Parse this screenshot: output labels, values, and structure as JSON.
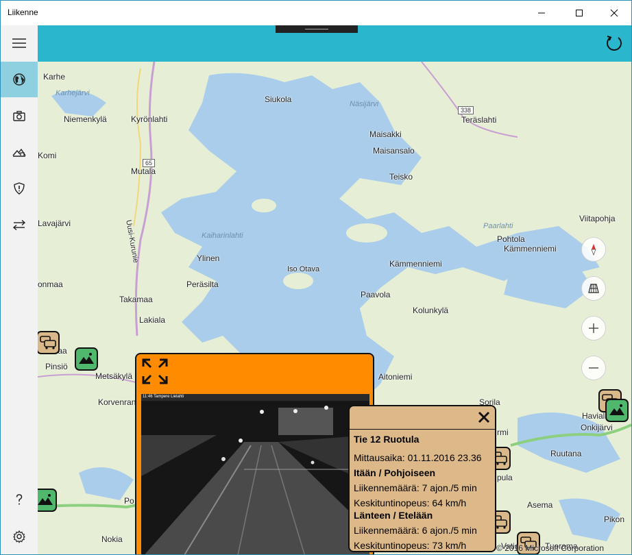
{
  "app": {
    "title": "Liikenne"
  },
  "window_controls": {
    "minimize": "minimize-icon",
    "maximize": "maximize-icon",
    "close": "close-icon"
  },
  "sidebar": {
    "items": [
      {
        "name": "menu",
        "icon": "hamburger-icon",
        "selected": false
      },
      {
        "name": "map",
        "icon": "globe-icon",
        "selected": true
      },
      {
        "name": "cameras",
        "icon": "camera-icon",
        "selected": false
      },
      {
        "name": "weather",
        "icon": "weather-icon",
        "selected": false
      },
      {
        "name": "traffic-safety",
        "icon": "shield-icon",
        "selected": false
      },
      {
        "name": "traffic-flow",
        "icon": "swap-arrows-icon",
        "selected": false
      },
      {
        "name": "help",
        "icon": "help-icon",
        "selected": false
      },
      {
        "name": "settings",
        "icon": "gear-icon",
        "selected": false
      }
    ]
  },
  "toolbar": {
    "refresh_icon": "refresh-icon",
    "accent": "#2ab7cd"
  },
  "map": {
    "places": [
      "Karhe",
      "Niemenkylä",
      "Kyrönlahti",
      "Komi",
      "Mutala",
      "Lavajärvi",
      "Ylinen",
      "Peräsilta",
      "Takamaa",
      "Lakiala",
      "Pinsiö",
      "Metsäkylä",
      "Korvenranta",
      "Nokia",
      "Siukola",
      "Maisakki",
      "Maisansalo",
      "Teisko",
      "Teräslahti",
      "Kämmenniemi",
      "Paavola",
      "Kolunkylä",
      "Aitoniemi",
      "Sorila",
      "Havialan",
      "Onkijärvi",
      "Ruutana",
      "Asema",
      "Pikon",
      "Pohtola",
      "Kämmenniemi",
      "Viitapohja",
      "Iso Otava",
      "Uusi-Kurunie",
      "onmaa",
      "ntinmaa",
      "Po",
      "rmi",
      "pula",
      "Tuorama",
      "Vatia"
    ],
    "water_labels": [
      "Karhejärvi",
      "Näsijärvi",
      "Kaiharinlahti",
      "Paarlahti"
    ],
    "route_shields": [
      "65",
      "338"
    ],
    "copyright": "© 2016 Microsoft Corporation"
  },
  "map_controls": {
    "compass": "compass-icon",
    "tilt": "tilt-view-icon",
    "zoom_in": "plus-icon",
    "zoom_out": "minus-icon"
  },
  "camera_popup": {
    "expand_icon": "expand-icon",
    "caption": "11:46 Tampere Lielahti",
    "color": "#ff8c00"
  },
  "station_popup": {
    "close_icon": "close-x-icon",
    "title": "Tie 12 Ruotula",
    "measured": "Mittausaika: 01.11.2016 23.36",
    "dir1_heading": "Itään / Pohjoiseen",
    "dir1_volume": "Liikennemäärä: 7 ajon./5 min",
    "dir1_speed": "Keskituntinopeus: 64 km/h",
    "dir2_heading": "Länteen / Etelään",
    "dir2_volume": "Liikennemäärä: 6 ajon./5 min",
    "dir2_speed": "Keskituntinopeus: 73 km/h",
    "color": "#ddb98a"
  },
  "markers": [
    {
      "type": "tms",
      "icon": "traffic-station-icon"
    },
    {
      "type": "camera",
      "icon": "camera-marker-icon"
    },
    {
      "type": "tms",
      "icon": "traffic-station-icon"
    },
    {
      "type": "camera",
      "icon": "camera-marker-icon"
    },
    {
      "type": "tms",
      "icon": "traffic-station-icon"
    },
    {
      "type": "camera",
      "icon": "camera-marker-icon"
    },
    {
      "type": "tms",
      "icon": "traffic-station-icon"
    },
    {
      "type": "tms",
      "icon": "traffic-station-icon"
    }
  ]
}
